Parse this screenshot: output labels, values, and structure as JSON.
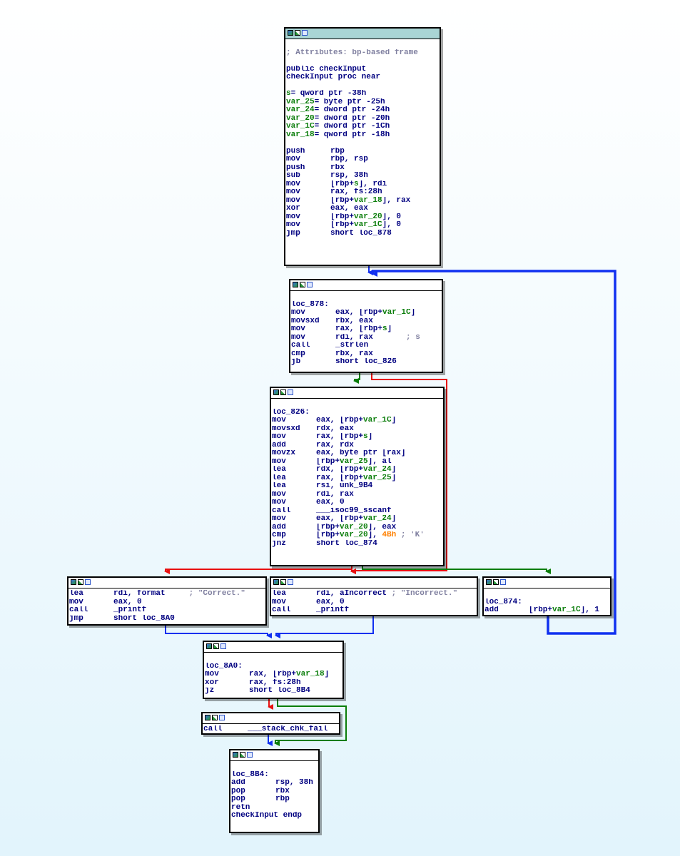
{
  "colors": {
    "edge_true": "#0a7d0a",
    "edge_false": "#e81010",
    "edge_uncond": "#1030f0",
    "entry_title_bar": "#a9d5d5"
  },
  "icons": [
    "graph-view-icon",
    "chart-icon",
    "text-view-icon"
  ],
  "nodes": {
    "entry": {
      "lines": [
        {
          "blank": true
        },
        {
          "comment": "; Attributes: bp-based frame"
        },
        {
          "blank": true
        },
        {
          "text": "public checkInput"
        },
        {
          "text": "checkInput proc near"
        },
        {
          "blank": true
        },
        {
          "var": "s",
          "def": "= qword ptr -38h"
        },
        {
          "var": "var_25",
          "def": "= byte ptr -25h"
        },
        {
          "var": "var_24",
          "def": "= dword ptr -24h"
        },
        {
          "var": "var_20",
          "def": "= dword ptr -20h"
        },
        {
          "var": "var_1C",
          "def": "= dword ptr -1Ch"
        },
        {
          "var": "var_18",
          "def": "= qword ptr -18h"
        },
        {
          "blank": true
        },
        {
          "mn": "push",
          "op": "rbp"
        },
        {
          "mn": "mov",
          "op": "rbp, rsp"
        },
        {
          "mn": "push",
          "op": "rbx"
        },
        {
          "mn": "sub",
          "op": "rsp, 38h"
        },
        {
          "mn": "mov",
          "op": "[rbp+s], rdi"
        },
        {
          "mn": "mov",
          "op": "rax, fs:28h"
        },
        {
          "mn": "mov",
          "op": "[rbp+var_18], rax"
        },
        {
          "mn": "xor",
          "op": "eax, eax"
        },
        {
          "mn": "mov",
          "op": "[rbp+var_20], 0"
        },
        {
          "mn": "mov",
          "op": "[rbp+var_1C], 0"
        },
        {
          "mn": "jmp",
          "op": "short loc_878"
        }
      ]
    },
    "loc_878": {
      "lines": [
        {
          "blank": true
        },
        {
          "label": "loc_878:"
        },
        {
          "mn": "mov",
          "op": "eax, [rbp+var_1C]"
        },
        {
          "mn": "movsxd",
          "op": "rbx, eax"
        },
        {
          "mn": "mov",
          "op": "rax, [rbp+s]"
        },
        {
          "mn": "mov",
          "op": "rdi, rax",
          "comment": "       ; s"
        },
        {
          "mn": "call",
          "op": "_strlen"
        },
        {
          "mn": "cmp",
          "op": "rbx, rax"
        },
        {
          "mn": "jb",
          "op": "short loc_826"
        }
      ]
    },
    "loc_826": {
      "lines": [
        {
          "blank": true
        },
        {
          "label": "loc_826:"
        },
        {
          "mn": "mov",
          "op": "eax, [rbp+var_1C]"
        },
        {
          "mn": "movsxd",
          "op": "rdx, eax"
        },
        {
          "mn": "mov",
          "op": "rax, [rbp+s]"
        },
        {
          "mn": "add",
          "op": "rax, rdx"
        },
        {
          "mn": "movzx",
          "op": "eax, byte ptr [rax]"
        },
        {
          "mn": "mov",
          "op": "[rbp+var_25], al"
        },
        {
          "mn": "lea",
          "op": "rdx, [rbp+var_24]"
        },
        {
          "mn": "lea",
          "op": "rax, [rbp+var_25]"
        },
        {
          "mn": "lea",
          "op": "rsi, unk_9B4"
        },
        {
          "mn": "mov",
          "op": "rdi, rax"
        },
        {
          "mn": "mov",
          "op": "eax, 0"
        },
        {
          "mn": "call",
          "op": "___isoc99_sscanf"
        },
        {
          "mn": "mov",
          "op": "eax, [rbp+var_24]"
        },
        {
          "mn": "add",
          "op": "[rbp+var_20], eax"
        },
        {
          "mn": "cmp",
          "op": "[rbp+var_20], ",
          "imm": "4Bh",
          "comment": " ; 'K'"
        },
        {
          "mn": "jnz",
          "op": "short loc_874"
        }
      ]
    },
    "correct": {
      "lines": [
        {
          "mn": "lea",
          "op": "rdi, format",
          "comment": "     ; \"Correct.\""
        },
        {
          "mn": "mov",
          "op": "eax, 0"
        },
        {
          "mn": "call",
          "op": "_printf"
        },
        {
          "mn": "jmp",
          "op": "short loc_8A0"
        }
      ]
    },
    "incorrect": {
      "lines": [
        {
          "mn": "lea",
          "op": "rdi, aIncorrect",
          "comment": " ; \"Incorrect.\""
        },
        {
          "mn": "mov",
          "op": "eax, 0"
        },
        {
          "mn": "call",
          "op": "_printf"
        }
      ]
    },
    "loc_874": {
      "lines": [
        {
          "blank": true
        },
        {
          "label": "loc_874:"
        },
        {
          "mn": "add",
          "op": "[rbp+var_1C], 1"
        }
      ]
    },
    "loc_8A0": {
      "lines": [
        {
          "blank": true
        },
        {
          "label": "loc_8A0:"
        },
        {
          "mn": "mov",
          "op": "rax, [rbp+var_18]"
        },
        {
          "mn": "xor",
          "op": "rax, fs:28h"
        },
        {
          "mn": "jz",
          "op": "short loc_8B4"
        }
      ]
    },
    "stack_fail": {
      "lines": [
        {
          "mn": "call",
          "op": "___stack_chk_fail"
        }
      ]
    },
    "loc_8B4": {
      "lines": [
        {
          "blank": true
        },
        {
          "label": "loc_8B4:"
        },
        {
          "mn": "add",
          "op": "rsp, 38h"
        },
        {
          "mn": "pop",
          "op": "rbx"
        },
        {
          "mn": "pop",
          "op": "rbp"
        },
        {
          "mn": "retn",
          "op": ""
        },
        {
          "text": "checkInput endp"
        }
      ]
    }
  }
}
